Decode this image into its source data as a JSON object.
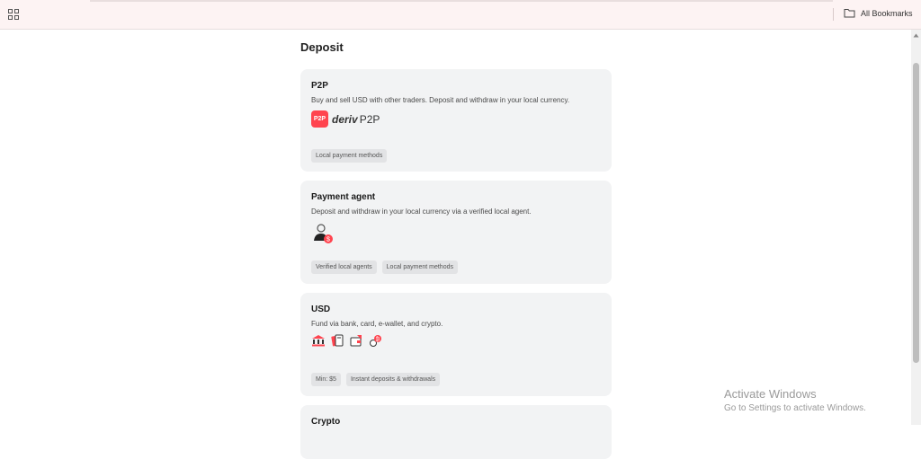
{
  "bookmarks_bar": {
    "apps_icon": "apps-grid-icon",
    "all_bookmarks_label": "All Bookmarks",
    "folder_icon": "folder-icon"
  },
  "page": {
    "title": "Deposit"
  },
  "cards": [
    {
      "title": "P2P",
      "description": "Buy and sell USD with other traders. Deposit and withdraw in your local currency.",
      "logo": {
        "badge": "P2P",
        "brand": "deriv",
        "product": "P2P"
      },
      "tags": [
        "Local payment methods"
      ]
    },
    {
      "title": "Payment agent",
      "description": "Deposit and withdraw in your local currency via a verified local agent.",
      "icon": "payment-agent-icon",
      "tags": [
        "Verified local agents",
        "Local payment methods"
      ]
    },
    {
      "title": "USD",
      "description": "Fund via bank, card, e-wallet, and crypto.",
      "icons": [
        "bank-icon",
        "card-icon",
        "e-wallet-icon",
        "crypto-icon"
      ],
      "tags": [
        "Min: $5",
        "Instant deposits & withdrawals"
      ]
    },
    {
      "title": "Crypto"
    }
  ],
  "watermark": {
    "title": "Activate Windows",
    "subtitle": "Go to Settings to activate Windows."
  },
  "colors": {
    "accent": "#ff444f",
    "card_bg": "#f2f3f4",
    "bookmarks_bar_bg": "#fdf3f3"
  }
}
